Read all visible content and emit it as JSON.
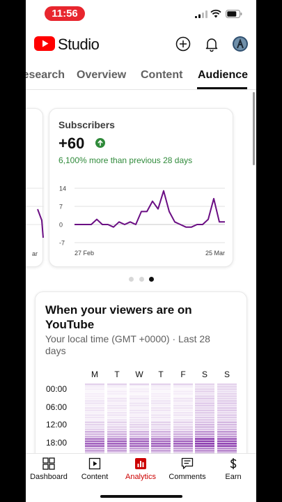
{
  "status_bar": {
    "time": "11:56"
  },
  "header": {
    "brand": "Studio"
  },
  "tabs": [
    {
      "label": "Research"
    },
    {
      "label": "Overview"
    },
    {
      "label": "Content"
    },
    {
      "label": "Audience"
    }
  ],
  "subscribers_card": {
    "title": "Subscribers",
    "value": "+60",
    "delta_text": "6,100% more than previous 28 days"
  },
  "chart_data": {
    "type": "line",
    "x_start_label": "27 Feb",
    "x_end_label": "25 Mar",
    "y_ticks": [
      "14",
      "7",
      "0",
      "-7"
    ],
    "ylim": [
      -7,
      14
    ],
    "values": [
      0,
      0,
      0,
      0,
      2,
      0,
      0,
      -1,
      1,
      0,
      1,
      0,
      5,
      5,
      9,
      6,
      13,
      5,
      1,
      0,
      -1,
      -1,
      0,
      0,
      2,
      10,
      1,
      1
    ],
    "line_color": "#6a0d83",
    "grid": true
  },
  "carousel": {
    "count": 3,
    "active": 2
  },
  "viewers_card": {
    "title": "When your viewers are on YouTube",
    "subtitle": "Your local time (GMT +0000) · Last 28 days",
    "days": [
      "M",
      "T",
      "W",
      "T",
      "F",
      "S",
      "S"
    ],
    "hour_labels": [
      "00:00",
      "06:00",
      "12:00",
      "18:00"
    ],
    "heat_color": "#7a1fa2"
  },
  "bottom_nav": [
    {
      "label": "Dashboard",
      "icon": "dashboard-icon"
    },
    {
      "label": "Content",
      "icon": "content-icon"
    },
    {
      "label": "Analytics",
      "icon": "analytics-icon",
      "active": true
    },
    {
      "label": "Comments",
      "icon": "comments-icon"
    },
    {
      "label": "Earn",
      "icon": "earn-icon"
    }
  ],
  "colors": {
    "brand_red": "#ff0000",
    "active_nav": "#cc0000",
    "positive": "#2f8a3a"
  }
}
